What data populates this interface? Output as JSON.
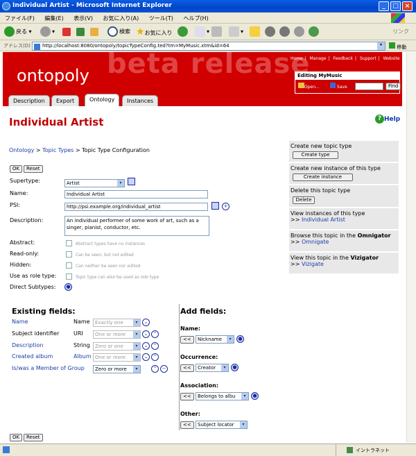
{
  "window": {
    "title": "Individual Artist - Microsoft Internet Explorer"
  },
  "menu": [
    "ファイル(F)",
    "編集(E)",
    "表示(V)",
    "お気に入り(A)",
    "ツール(T)",
    "ヘルプ(H)"
  ],
  "toolbar": {
    "back": "戻る",
    "search": "検索",
    "favorites": "お気に入り",
    "links": "リンク"
  },
  "address": {
    "label": "アドレス(D)",
    "url": "http://localhost:8080/ontopoly/topicTypeConfig.ted?tm=MyMusic.xtm&id=64",
    "go": "移動"
  },
  "header": {
    "watermark": "beta release",
    "logo": "ontopoly",
    "links": [
      "Home",
      "Manage",
      "Feedback",
      "Support",
      "Website"
    ],
    "editing": "Editing MyMusic",
    "open": "Open...",
    "save": "Save",
    "find": "Find"
  },
  "tabs": [
    "Description",
    "Export",
    "Ontology",
    "Instances"
  ],
  "page": {
    "title": "Individual Artist",
    "help": "Help"
  },
  "breadcrumb": {
    "ontology": "Ontology",
    "topic_types": "Topic Types",
    "sep": ">",
    "current": "Topic Type Configuration"
  },
  "buttons": {
    "ok": "OK",
    "reset": "Reset"
  },
  "form": {
    "supertype_label": "Supertype:",
    "supertype_value": "Artist",
    "name_label": "Name:",
    "name_value": "Individual Artist",
    "psi_label": "PSI:",
    "psi_value": "http://psi.example.org/individual_artist",
    "description_label": "Description:",
    "description_value": "An individual performer of some work of art, such as a singer, pianist, conductor, etc.",
    "abstract_label": "Abstract:",
    "abstract_hint": "Abstract types have no instances",
    "readonly_label": "Read-only:",
    "readonly_hint": "Can be seen, but not edited",
    "hidden_label": "Hidden:",
    "hidden_hint": "Can neither be seen nor edited",
    "roletype_label": "Use as role type:",
    "roletype_hint": "Topic type can also be used as role type",
    "subtypes_label": "Direct Subtypes:"
  },
  "sidebar": {
    "create_type_title": "Create new topic type",
    "create_type_btn": "Create type",
    "create_instance_title": "Create new instance of this type",
    "create_instance_btn": "Create instance",
    "delete_title": "Delete this topic type",
    "delete_btn": "Delete",
    "view_instances_title": "View instances of this type",
    "view_instances_link": "Individual Artist",
    "browse_prefix": "Browse this topic in the",
    "browse_app": "Omnigator",
    "browse_link": "Omnigate",
    "view_prefix": "View this topic in the",
    "view_app": "Vizigator",
    "view_link": "Vizigate",
    "arrow": ">>"
  },
  "existing": {
    "title": "Existing fields:",
    "rows": [
      {
        "field": "Name",
        "type": "Name",
        "card": "Exactly one",
        "disabled": true
      },
      {
        "field": "Subject identifier",
        "type": "URI",
        "card": "One or more",
        "disabled": true
      },
      {
        "field": "Description",
        "type": "String",
        "card": "Zero or one",
        "disabled": true
      },
      {
        "field": "Created album",
        "type": "Album",
        "card": "One or more",
        "disabled": true
      },
      {
        "field": "Is/was a Member of Group",
        "type": "",
        "card": "Zero or more",
        "disabled": false
      }
    ]
  },
  "add": {
    "title": "Add fields:",
    "btn": "<<",
    "groups": [
      {
        "label": "Name:",
        "value": "Nickname"
      },
      {
        "label": "Occurrence:",
        "value": "Creator"
      },
      {
        "label": "Association:",
        "value": "Belongs to albu"
      },
      {
        "label": "Other:",
        "value": "Subject locator"
      }
    ]
  },
  "status": {
    "zone": "イントラネット"
  }
}
